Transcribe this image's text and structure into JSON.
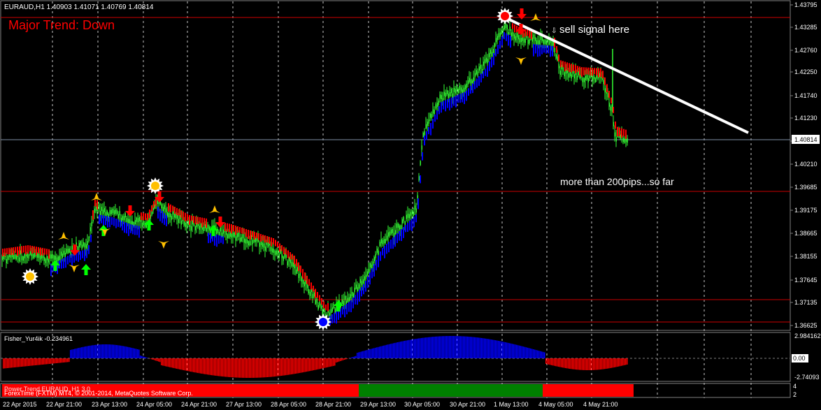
{
  "header": {
    "symbol_info": "EURAUD,H1  1.40903 1.41071 1.40769 1.40814",
    "trend_label": "Major Trend: Down"
  },
  "annotations": {
    "sell_signal": "sell signal here",
    "pips_note": "more than 200pips...so far"
  },
  "price_axis": {
    "ticks": [
      "1.43795",
      "1.43285",
      "1.42760",
      "1.42250",
      "1.41740",
      "1.41230",
      "1.40720",
      "1.40210",
      "1.39685",
      "1.39175",
      "1.38665",
      "1.38155",
      "1.37645",
      "1.37135",
      "1.36625"
    ],
    "current_price": "1.40814"
  },
  "indicator": {
    "label": "Fisher_Yur4ik -0.234961",
    "axis_ticks": [
      "2.984162",
      "0.00",
      "-2.74093"
    ]
  },
  "bottom_panel": {
    "label": "Power Trend EURAUD, H1 3.0",
    "copyright": "ForexTime (FXTM) MT4, © 2001-2014, MetaQuotes Software Corp.",
    "axis_ticks": [
      "4",
      "2"
    ]
  },
  "time_axis": {
    "ticks": [
      "22 Apr 2015",
      "22 Apr 21:00",
      "23 Apr 13:00",
      "24 Apr 05:00",
      "24 Apr 21:00",
      "27 Apr 13:00",
      "28 Apr 05:00",
      "28 Apr 21:00",
      "29 Apr 13:00",
      "30 Apr 05:00",
      "30 Apr 21:00",
      "1 May 13:00",
      "4 May 05:00",
      "4 May 21:00"
    ]
  },
  "colors": {
    "background": "#000000",
    "candle_up": "#33ff33",
    "trend_down": "#ff0000",
    "trend_up": "#0000ff",
    "trend_label": "#ff0000",
    "trendline": "#ffffff",
    "level_line": "#cc0000",
    "bull_segment": "#008000",
    "bear_segment": "#ff0000",
    "arrow_up": "#00ff00",
    "arrow_down": "#ff0000",
    "fractal": "#ffc000"
  }
}
